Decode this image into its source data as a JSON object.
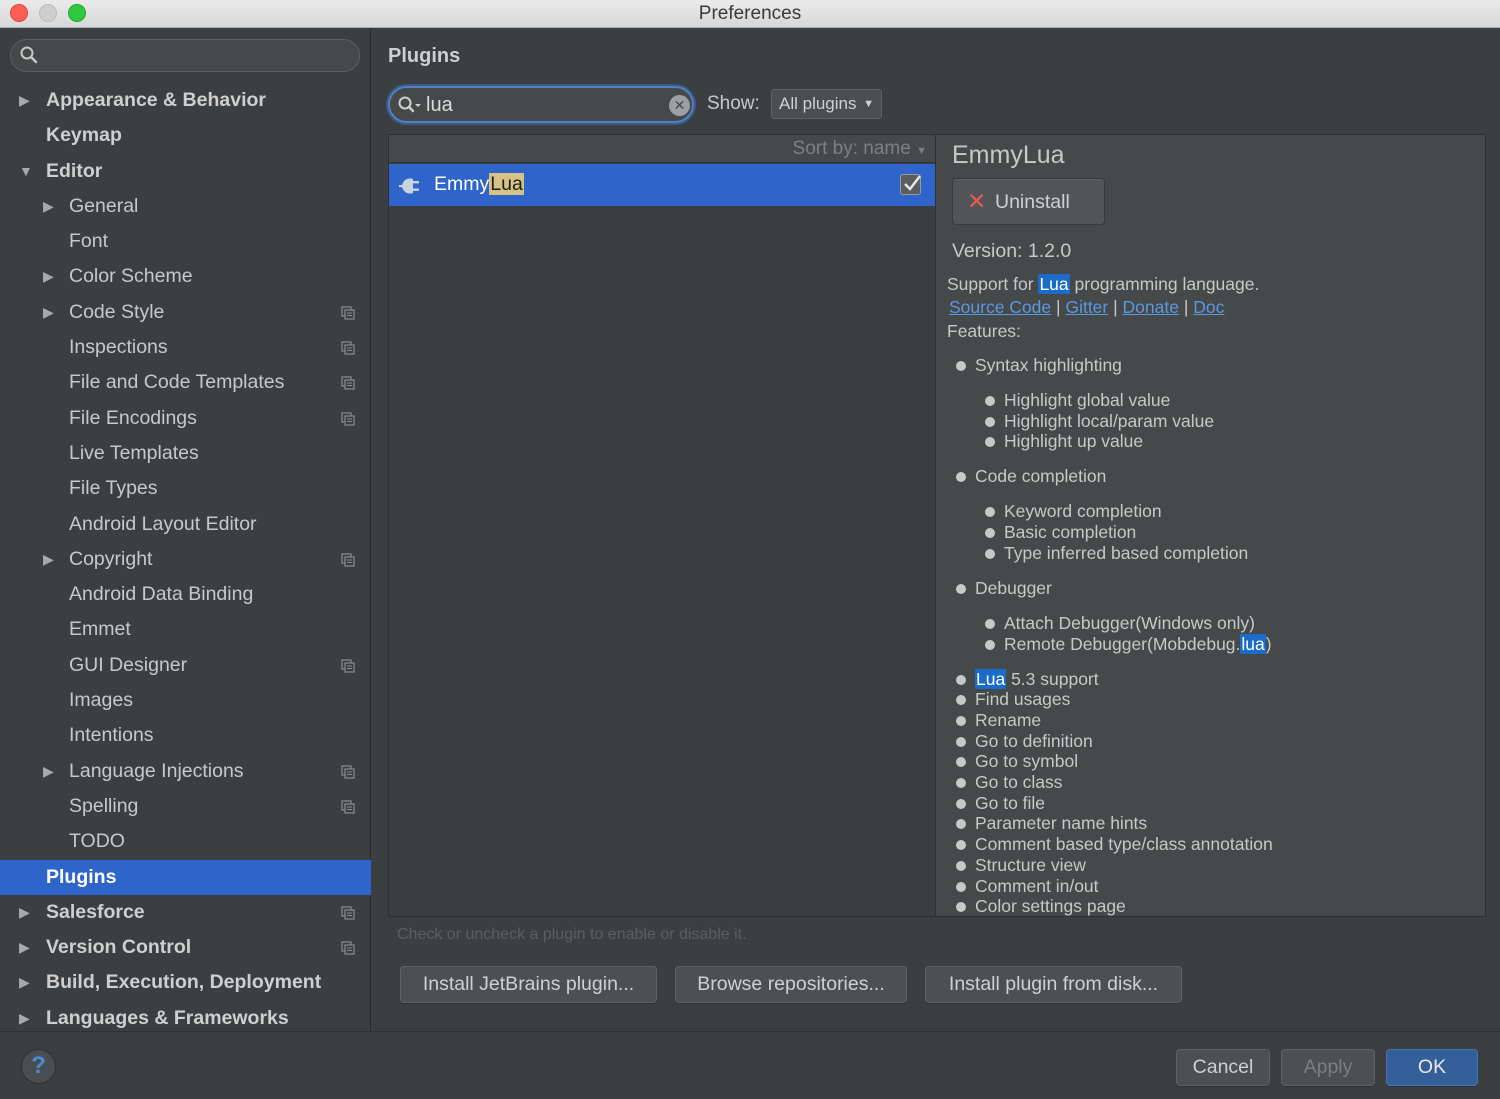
{
  "window": {
    "title": "Preferences"
  },
  "sidebar": {
    "search": {
      "value": "",
      "placeholder": ""
    },
    "items": [
      {
        "label": "Appearance & Behavior",
        "level": 0,
        "arrow": "collapsed",
        "bold": true,
        "icon": ""
      },
      {
        "label": "Keymap",
        "level": 0,
        "arrow": "",
        "bold": true,
        "icon": ""
      },
      {
        "label": "Editor",
        "level": 0,
        "arrow": "expanded",
        "bold": true,
        "icon": ""
      },
      {
        "label": "General",
        "level": 1,
        "arrow": "collapsed",
        "bold": false,
        "icon": ""
      },
      {
        "label": "Font",
        "level": 1,
        "arrow": "",
        "bold": false,
        "icon": ""
      },
      {
        "label": "Color Scheme",
        "level": 1,
        "arrow": "collapsed",
        "bold": false,
        "icon": ""
      },
      {
        "label": "Code Style",
        "level": 1,
        "arrow": "collapsed",
        "bold": false,
        "icon": "copy-icon"
      },
      {
        "label": "Inspections",
        "level": 1,
        "arrow": "",
        "bold": false,
        "icon": "copy-icon"
      },
      {
        "label": "File and Code Templates",
        "level": 1,
        "arrow": "",
        "bold": false,
        "icon": "copy-icon"
      },
      {
        "label": "File Encodings",
        "level": 1,
        "arrow": "",
        "bold": false,
        "icon": "copy-icon"
      },
      {
        "label": "Live Templates",
        "level": 1,
        "arrow": "",
        "bold": false,
        "icon": ""
      },
      {
        "label": "File Types",
        "level": 1,
        "arrow": "",
        "bold": false,
        "icon": ""
      },
      {
        "label": "Android Layout Editor",
        "level": 1,
        "arrow": "",
        "bold": false,
        "icon": ""
      },
      {
        "label": "Copyright",
        "level": 1,
        "arrow": "collapsed",
        "bold": false,
        "icon": "copy-icon"
      },
      {
        "label": "Android Data Binding",
        "level": 1,
        "arrow": "",
        "bold": false,
        "icon": ""
      },
      {
        "label": "Emmet",
        "level": 1,
        "arrow": "",
        "bold": false,
        "icon": ""
      },
      {
        "label": "GUI Designer",
        "level": 1,
        "arrow": "",
        "bold": false,
        "icon": "copy-icon"
      },
      {
        "label": "Images",
        "level": 1,
        "arrow": "",
        "bold": false,
        "icon": ""
      },
      {
        "label": "Intentions",
        "level": 1,
        "arrow": "",
        "bold": false,
        "icon": ""
      },
      {
        "label": "Language Injections",
        "level": 1,
        "arrow": "collapsed",
        "bold": false,
        "icon": "copy-icon"
      },
      {
        "label": "Spelling",
        "level": 1,
        "arrow": "",
        "bold": false,
        "icon": "copy-icon"
      },
      {
        "label": "TODO",
        "level": 1,
        "arrow": "",
        "bold": false,
        "icon": ""
      },
      {
        "label": "Plugins",
        "level": 0,
        "arrow": "",
        "bold": true,
        "icon": "",
        "selected": true
      },
      {
        "label": "Salesforce",
        "level": 0,
        "arrow": "collapsed",
        "bold": true,
        "icon": "copy-icon"
      },
      {
        "label": "Version Control",
        "level": 0,
        "arrow": "collapsed",
        "bold": true,
        "icon": "copy-icon"
      },
      {
        "label": "Build, Execution, Deployment",
        "level": 0,
        "arrow": "collapsed",
        "bold": true,
        "icon": ""
      },
      {
        "label": "Languages & Frameworks",
        "level": 0,
        "arrow": "collapsed",
        "bold": true,
        "icon": ""
      }
    ]
  },
  "main": {
    "title": "Plugins",
    "search": {
      "value": "lua",
      "clear_icon": "clear-icon"
    },
    "show": {
      "label": "Show:",
      "selected": "All plugins"
    },
    "sort": {
      "label": "Sort by: name"
    },
    "plugins": [
      {
        "name_prefix": "Emmy",
        "name_match": "Lua",
        "enabled": true,
        "icon": "plug-icon"
      }
    ],
    "detail": {
      "name": "EmmyLua",
      "uninstall_label": "Uninstall",
      "version": "Version: 1.2.0",
      "desc_prefix": "Support for ",
      "desc_match": "Lua",
      "desc_suffix": " programming language.",
      "links": [
        "Source Code",
        "Gitter",
        "Donate",
        "Doc"
      ],
      "link_separator": "|",
      "features_label": "Features:",
      "features": [
        {
          "text": "Syntax highlighting",
          "level": 0
        },
        {
          "text": "Highlight global value",
          "level": 1
        },
        {
          "text": "Highlight local/param value",
          "level": 1
        },
        {
          "text": "Highlight up value",
          "level": 1
        },
        {
          "text": "Code completion",
          "level": 0
        },
        {
          "text": "Keyword completion",
          "level": 1
        },
        {
          "text": "Basic completion",
          "level": 1
        },
        {
          "text": "Type inferred based completion",
          "level": 1
        },
        {
          "text": "Debugger",
          "level": 0
        },
        {
          "text": "Attach Debugger(Windows only)",
          "level": 1
        },
        {
          "text": "Remote Debugger(Mobdebug.",
          "level": 1,
          "match": "lua",
          "suffix": ")"
        },
        {
          "text": "",
          "level": 0,
          "match": "Lua",
          "suffix": " 5.3 support",
          "match_first": true
        },
        {
          "text": "Find usages",
          "level": 0
        },
        {
          "text": "Rename",
          "level": 0
        },
        {
          "text": "Go to definition",
          "level": 0
        },
        {
          "text": "Go to symbol",
          "level": 0
        },
        {
          "text": "Go to class",
          "level": 0
        },
        {
          "text": "Go to file",
          "level": 0
        },
        {
          "text": "Parameter name hints",
          "level": 0
        },
        {
          "text": "Comment based type/class annotation",
          "level": 0
        },
        {
          "text": "Structure view",
          "level": 0
        },
        {
          "text": "Comment in/out",
          "level": 0
        },
        {
          "text": "Color settings page",
          "level": 0
        }
      ]
    },
    "hint": "Check or uncheck a plugin to enable or disable it.",
    "buttons": {
      "install_jetbrains": "Install JetBrains plugin...",
      "browse": "Browse repositories...",
      "install_disk": "Install plugin from disk..."
    }
  },
  "footer": {
    "help": "?",
    "cancel": "Cancel",
    "apply": "Apply",
    "ok": "OK"
  },
  "colors": {
    "selection": "#2f65ca",
    "match_highlight": "#d6c384",
    "text_highlight": "#1a6cc8",
    "link": "#5a98e0",
    "uninstall_x": "#e25b4f"
  }
}
